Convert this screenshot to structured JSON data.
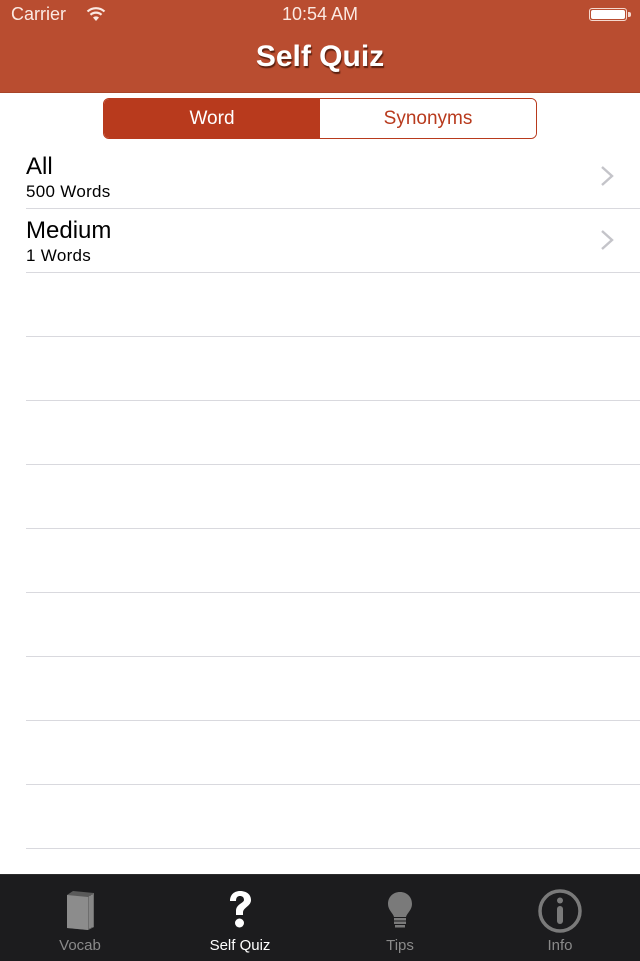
{
  "status_bar": {
    "carrier": "Carrier",
    "time": "10:54 AM",
    "wifi_icon": "wifi-icon",
    "battery_icon": "battery-icon",
    "battery_level": 1.0
  },
  "nav": {
    "title": "Self Quiz",
    "bar_color": "#b94d30"
  },
  "segmented_control": {
    "segments": [
      {
        "label": "Word",
        "selected": true
      },
      {
        "label": "Synonyms",
        "selected": false
      }
    ],
    "accent_color": "#b83a1d"
  },
  "list": {
    "items": [
      {
        "title": "All",
        "subtitle": "500 Words",
        "accessory": "chevron-right-icon"
      },
      {
        "title": "Medium",
        "subtitle": "1 Words",
        "accessory": "chevron-right-icon"
      }
    ]
  },
  "tab_bar": {
    "items": [
      {
        "label": "Vocab",
        "icon": "book-icon",
        "selected": false
      },
      {
        "label": "Self Quiz",
        "icon": "question-mark-icon",
        "selected": true
      },
      {
        "label": "Tips",
        "icon": "lightbulb-icon",
        "selected": false
      },
      {
        "label": "Info",
        "icon": "info-icon",
        "selected": false
      }
    ]
  }
}
